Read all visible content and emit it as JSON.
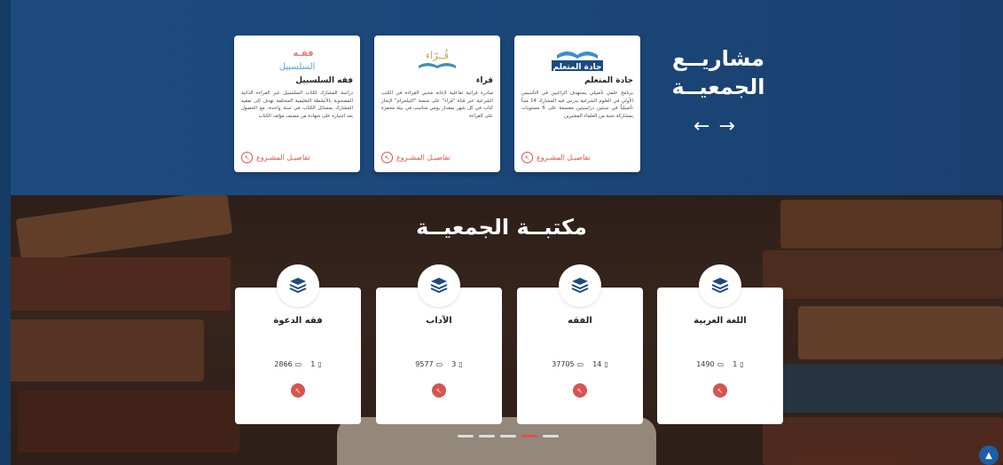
{
  "projects": {
    "title_line1": "مشاريــع",
    "title_line2": "الجمعيــة",
    "prev_arrow": "←",
    "next_arrow": "→",
    "cards": [
      {
        "name": "جادة المتعلم",
        "logo_text": "جادة المتعلم",
        "description": "برنامج علمي تأصيلي يستهدف الراغبين في التأسيس الأولي في العلوم الشرعية يدرس فيه المشارك 14 متناً تأصيلياً في سنتين دراسيتين مقسمة على 6 مستويات بمشاركة نخبة من العلماء المعتبرين",
        "link_label": "تفاصيـل المشـروع"
      },
      {
        "name": "قراء",
        "logo_text": "قُــرّاء",
        "description": "مبادرة قرائية تفاعلية لإعانة محبي القراءة في الكتب الشرعية عبر قناة \"قراء\" على منصة \"التيلجرام\" لإنجاز كتاب في كل شهر بمقدار يومي مناسب في بيئة محفزة على القراءة",
        "link_label": "تفاصيـل المشـروع"
      },
      {
        "name": "فقه السلسبيل",
        "logo_text_1": "فقـه",
        "logo_text_2": "السلسبيل",
        "description": "دراسة المشارك لكتاب السلسبيل عبر القراءة الذاتية المصحوبة بالأنشطة التعليمية المختلفة تهدف إلى تفقيه المشارك بمسائل الكتاب في سنة واحدة، مع الحصول بعد اجتيازه على شهادة من مصنف مؤلف الكتاب",
        "link_label": "تفاصيـل المشـروع"
      }
    ]
  },
  "library": {
    "title": "مكتبــة الجمعيــة",
    "categories": [
      {
        "name": "اللغة العربية",
        "books": "1",
        "views": "1490"
      },
      {
        "name": "الفقه",
        "books": "14",
        "views": "37705"
      },
      {
        "name": "الآداب",
        "books": "3",
        "views": "9577"
      },
      {
        "name": "فقه الدعوة",
        "books": "1",
        "views": "2866"
      }
    ],
    "slide_count": 5,
    "active_slide": 4
  },
  "colors": {
    "projects_bg": "#1d4b7e",
    "accent": "#d9534f",
    "scroll_top": "#1b5fa8"
  }
}
